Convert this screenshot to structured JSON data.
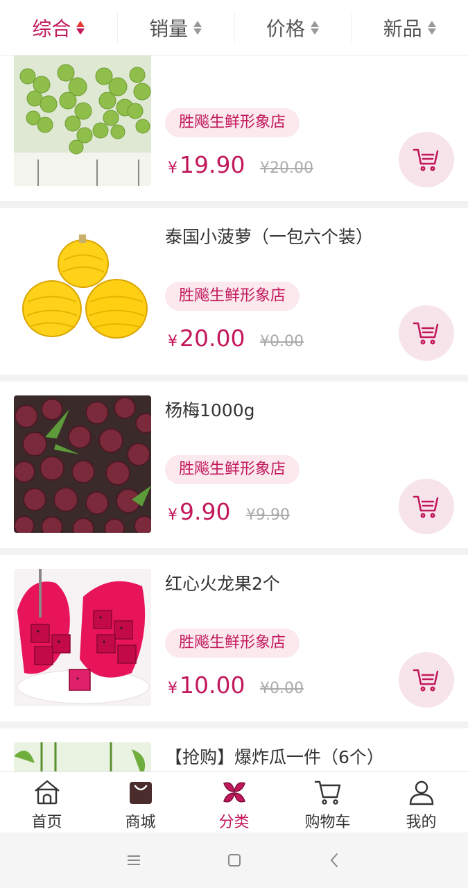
{
  "sort": {
    "items": [
      {
        "label": "综合"
      },
      {
        "label": "销量"
      },
      {
        "label": "价格"
      },
      {
        "label": "新品"
      }
    ],
    "active_index": 0
  },
  "products": [
    {
      "title": "",
      "store": "胜飚生鲜形象店",
      "currency": "¥",
      "price": "19.90",
      "original_price": "¥20.00",
      "image": "green-grapes"
    },
    {
      "title": "泰国小菠萝（一包六个装）",
      "store": "胜飚生鲜形象店",
      "currency": "¥",
      "price": "20.00",
      "original_price": "¥0.00",
      "image": "pineapples"
    },
    {
      "title": "杨梅1000g",
      "store": "胜飚生鲜形象店",
      "currency": "¥",
      "price": "9.90",
      "original_price": "¥9.90",
      "image": "bayberries"
    },
    {
      "title": "红心火龙果2个",
      "store": "胜飚生鲜形象店",
      "currency": "¥",
      "price": "10.00",
      "original_price": "¥0.00",
      "image": "dragon-fruit"
    },
    {
      "title": "【抢购】爆炸瓜一件（6个）",
      "store": "",
      "currency": "",
      "price": "",
      "original_price": "",
      "image": "watermelon"
    }
  ],
  "bottom_nav": [
    {
      "label": "首页",
      "icon": "home-icon"
    },
    {
      "label": "商城",
      "icon": "shopping-bag-icon"
    },
    {
      "label": "分类",
      "icon": "category-icon"
    },
    {
      "label": "购物车",
      "icon": "cart-icon"
    },
    {
      "label": "我的",
      "icon": "user-icon"
    }
  ],
  "bottom_nav_active": 2,
  "colors": {
    "accent": "#c2185b",
    "accent_light": "#fbe9ee",
    "text": "#333333",
    "muted": "#aaaaaa"
  }
}
